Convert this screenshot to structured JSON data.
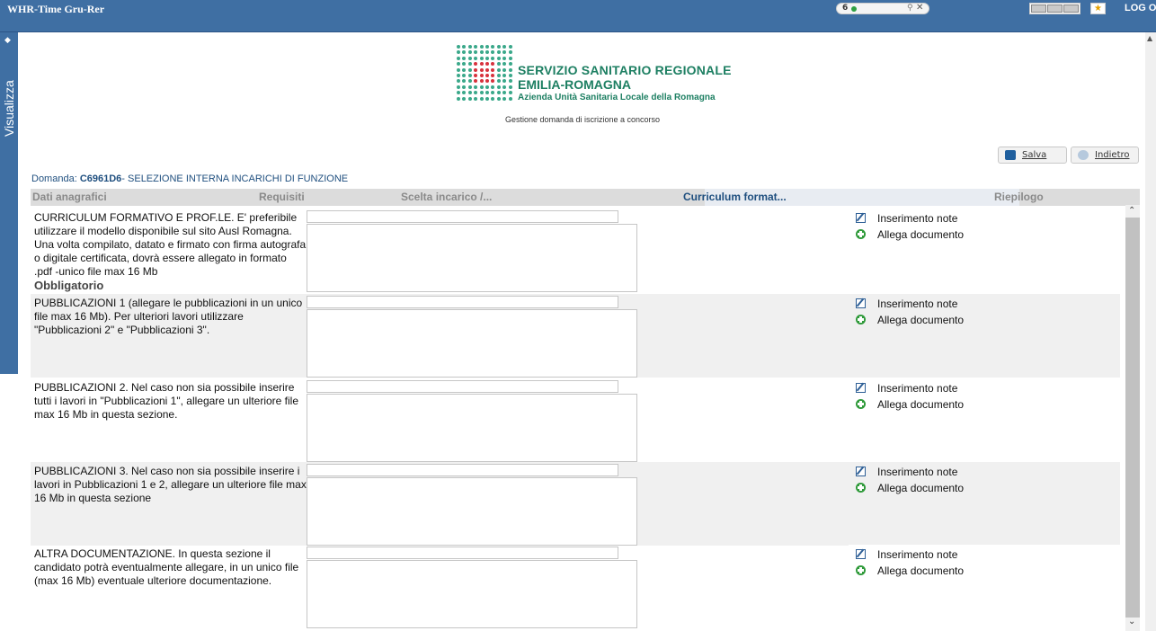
{
  "topbar": {
    "app_title": "WHR-Time Gru-Rer",
    "counter": "6",
    "logout": "LOG OUT"
  },
  "sidebar": {
    "tab_label": "Visualizza"
  },
  "header": {
    "logo_line1": "SERVIZIO SANITARIO REGIONALE",
    "logo_line2": "EMILIA-ROMAGNA",
    "logo_line3": "Azienda Unità Sanitaria Locale della Romagna",
    "subtitle": "Gestione domanda di iscrizione a concorso"
  },
  "toolbar": {
    "save_label": "Salva",
    "back_label": "Indietro"
  },
  "domanda": {
    "prefix": "Domanda: ",
    "code": "C6961D6",
    "description": "- SELEZIONE INTERNA INCARICHI DI FUNZIONE"
  },
  "tabs": [
    {
      "label": "Dati anagrafici",
      "active": false
    },
    {
      "label": "Requisiti",
      "active": false
    },
    {
      "label": "Scelta incarico /...",
      "active": false
    },
    {
      "label": "Curriculum format...",
      "active": true
    },
    {
      "label": "Riepilogo",
      "active": false
    }
  ],
  "rows": [
    {
      "label": "CURRICULUM FORMATIVO E PROF.LE. E' preferibile utilizzare il modello disponibile sul sito Ausl Romagna. Una volta compilato, datato e firmato con firma autografa o digitale certificata, dovrà essere allegato in formato .pdf -unico file max 16 Mb",
      "required": "Obbligatorio",
      "input_value": "",
      "textarea_value": "",
      "note_label": "Inserimento note",
      "attach_label": "Allega documento"
    },
    {
      "label": "PUBBLICAZIONI 1 (allegare le pubblicazioni in un unico file max 16 Mb). Per ulteriori lavori utilizzare \"Pubblicazioni 2\" e \"Pubblicazioni 3\".",
      "required": "",
      "input_value": "",
      "textarea_value": "",
      "note_label": "Inserimento note",
      "attach_label": "Allega documento"
    },
    {
      "label": "PUBBLICAZIONI 2. Nel caso non sia possibile inserire tutti i lavori in \"Pubblicazioni 1\", allegare un ulteriore file max 16 Mb in questa sezione.",
      "required": "",
      "input_value": "",
      "textarea_value": "",
      "note_label": "Inserimento note",
      "attach_label": "Allega documento"
    },
    {
      "label": "PUBBLICAZIONI 3. Nel caso non sia possibile inserire i lavori in Pubblicazioni 1 e 2, allegare un ulteriore file max 16 Mb in questa sezione",
      "required": "",
      "input_value": "",
      "textarea_value": "",
      "note_label": "Inserimento note",
      "attach_label": "Allega documento"
    },
    {
      "label": "ALTRA DOCUMENTAZIONE. In questa sezione il candidato potrà eventualmente allegare, in un unico file (max 16 Mb) eventuale ulteriore documentazione.",
      "required": "",
      "input_value": "",
      "textarea_value": "",
      "note_label": "Inserimento note",
      "attach_label": "Allega documento"
    }
  ],
  "colors": {
    "topbar": "#3f6fa3",
    "brand_green": "#1d7f62",
    "brand_red": "#d8323d",
    "active_tab": "#1f4f7f"
  },
  "icons": {
    "note": "edit-note-icon",
    "attach": "add-document-icon",
    "save": "floppy-disk-icon",
    "back": "back-arrow-icon"
  }
}
